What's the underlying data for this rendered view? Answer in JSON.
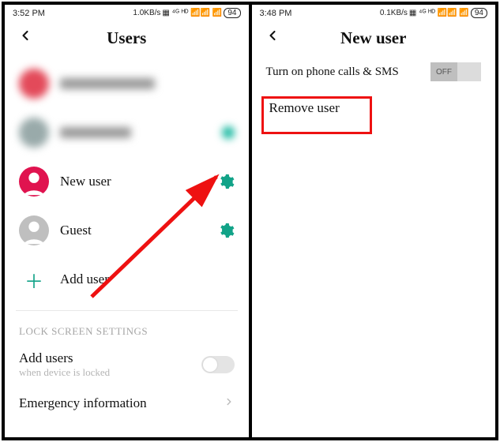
{
  "left": {
    "status": {
      "time": "3:52 PM",
      "net": "1.0KB/s",
      "battery": "94"
    },
    "title": "Users",
    "users": {
      "new_user": "New user",
      "guest": "Guest",
      "add_user": "Add user"
    },
    "lock_section": "LOCK SCREEN SETTINGS",
    "add_users": {
      "label": "Add users",
      "sub": "when device is locked"
    },
    "emergency": "Emergency information"
  },
  "right": {
    "status": {
      "time": "3:48 PM",
      "net": "0.1KB/s",
      "battery": "94"
    },
    "title": "New user",
    "toggle_label": "Turn on phone calls & SMS",
    "toggle_state": "OFF",
    "remove": "Remove user"
  }
}
